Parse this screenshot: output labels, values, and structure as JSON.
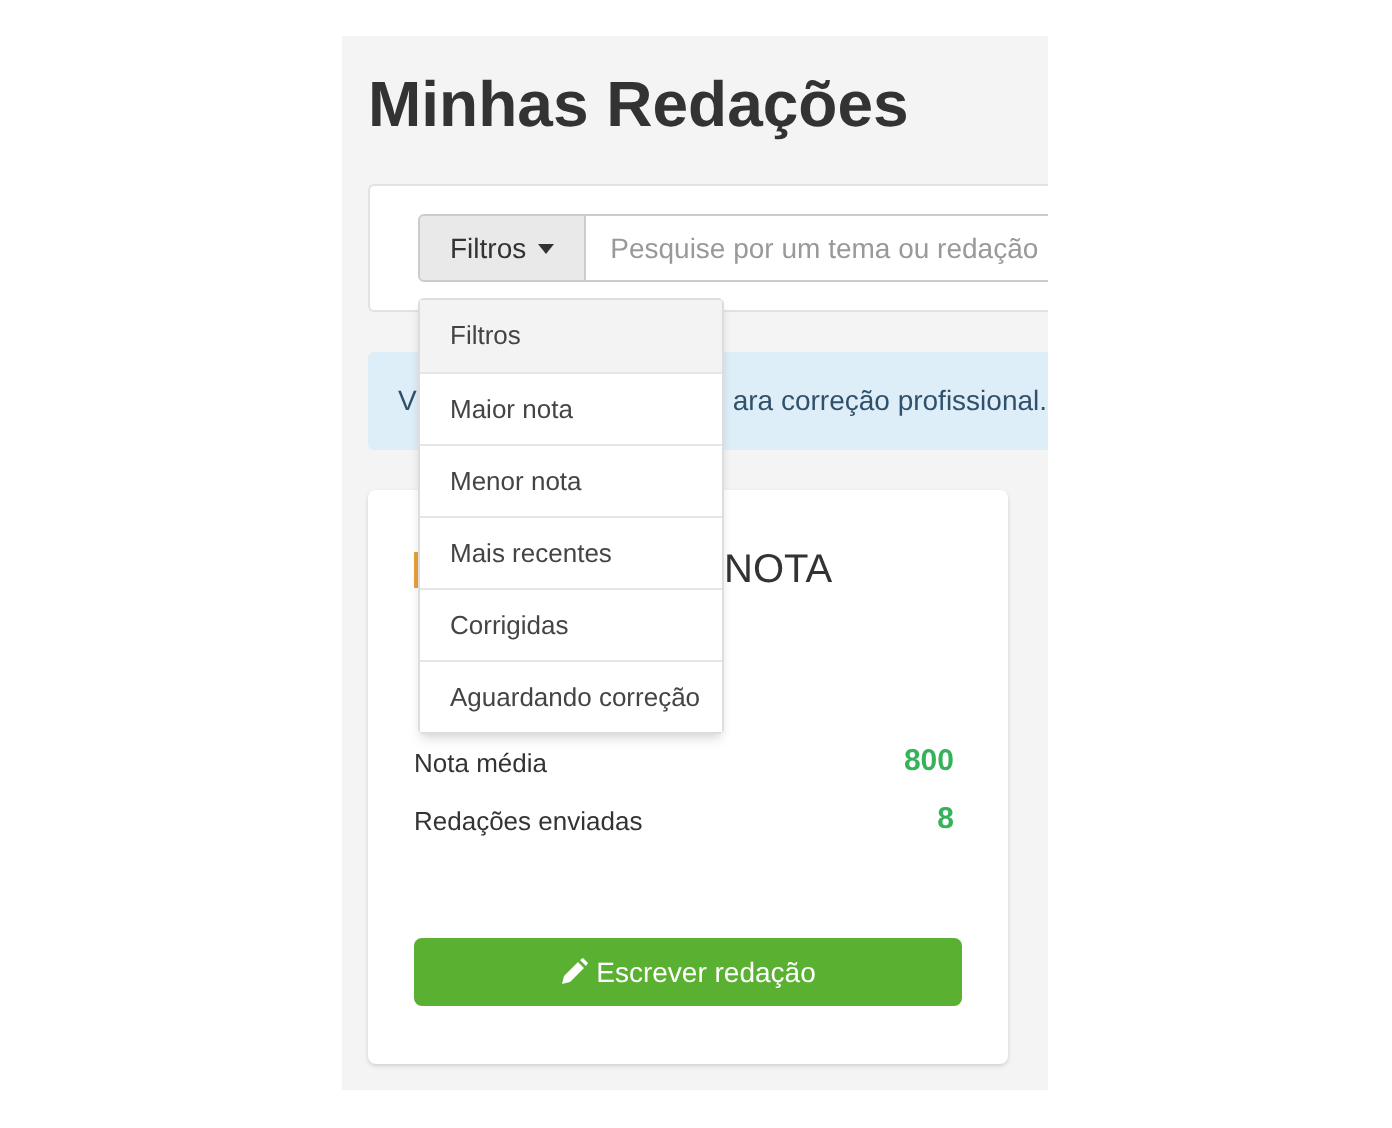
{
  "title": "Minhas Redações",
  "search": {
    "filter_button": "Filtros",
    "placeholder": "Pesquise por um tema ou redação"
  },
  "filter_menu": [
    {
      "label": "Filtros",
      "selected": true
    },
    {
      "label": "Maior nota",
      "selected": false
    },
    {
      "label": "Menor nota",
      "selected": false
    },
    {
      "label": "Mais recentes",
      "selected": false
    },
    {
      "label": "Corrigidas",
      "selected": false
    },
    {
      "label": "Aguardando correção",
      "selected": false
    }
  ],
  "alert": {
    "text_start": "V",
    "text_end": "ara correção profissional."
  },
  "card": {
    "title": "NOTA",
    "stats": [
      {
        "label": "Nota média",
        "value": "800"
      },
      {
        "label": "Redações enviadas",
        "value": "8"
      }
    ],
    "button": "Escrever redação"
  }
}
